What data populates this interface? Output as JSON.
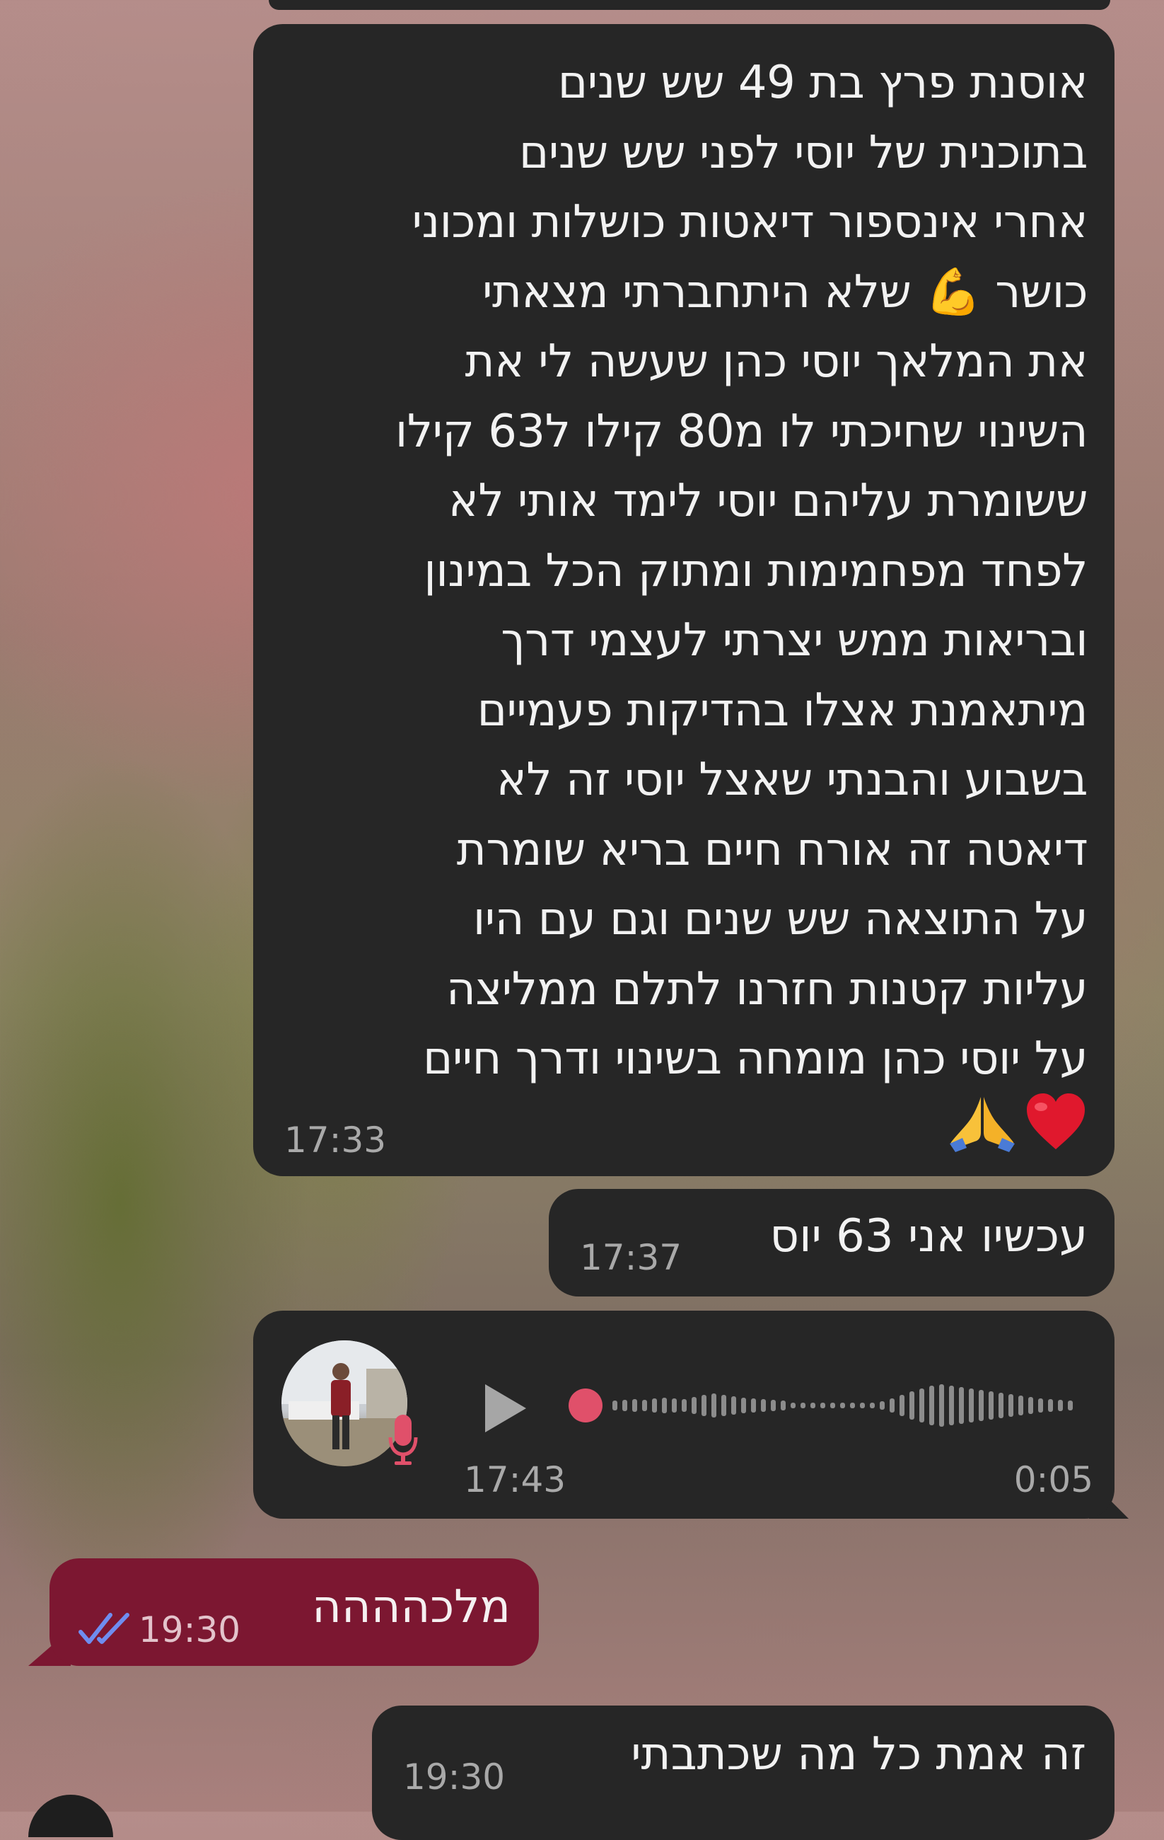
{
  "chat": {
    "long_message": {
      "lines": [
        "אוסנת פרץ בת 49 שש שנים",
        "בתוכנית של יוסי  לפני שש שנים",
        "אחרי אינספור דיאטות כושלות ומכוני",
        "כושר 💪 שלא היתחברתי מצאתי",
        "את המלאך יוסי כהן שעשה לי את",
        "השינוי שחיכתי לו מ80 קילו ל63 קילו",
        "ששומרת עליהם יוסי לימד אותי לא",
        "לפחד מפחמימות ומתוק הכל במינון",
        "ובריאות ממש יצרתי לעצמי דרך",
        "מיתאמנת אצלו בהדיקות פעמיים",
        "בשבוע והבנתי שאצל יוסי זה לא",
        "דיאטה זה אורח חיים בריא שומרת",
        "על התוצאה שש שנים וגם עם היו",
        "עליות קטנות חזרנו לתלם ממליצה",
        "על יוסי כהן מומחה בשינוי ודרך חיים"
      ],
      "time": "17:33"
    },
    "now_message": {
      "text": "עכשיו אני 63 יוס",
      "time": "17:37"
    },
    "voice_message": {
      "duration": "0:05",
      "time": "17:43"
    },
    "my_message": {
      "text": "מלכהההה",
      "time": "19:30",
      "status": "read"
    },
    "last_message": {
      "text": "זה אמת כל מה שכתבתי",
      "time": "19:30"
    }
  },
  "colors": {
    "incoming_bubble": "#262626",
    "outgoing_bubble": "#7c1731",
    "voice_accent": "#e0506a",
    "read_ticks": "#6f8df0"
  },
  "icons": [
    "flexed-biceps-emoji",
    "red-heart-emoji",
    "folded-hands-emoji",
    "microphone-icon",
    "play-icon",
    "double-check-icon"
  ]
}
